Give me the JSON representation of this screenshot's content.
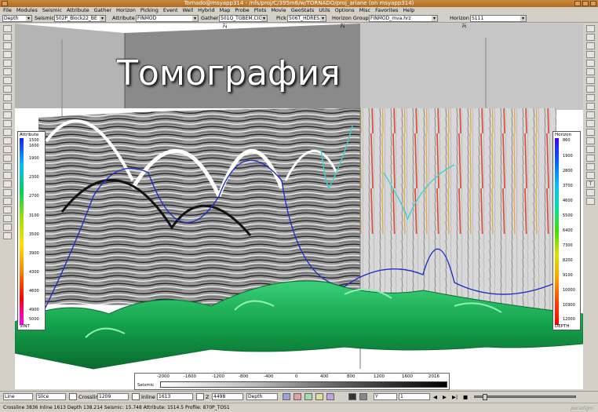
{
  "window": {
    "title": "Tornado@msyapp314 - /nfs/proj/C/395m6/w/TORNADO/proj_ariane (on msyapp314)"
  },
  "menu": [
    "File",
    "Modules",
    "Seismic",
    "Attribute",
    "Gather",
    "Horizon",
    "Picking",
    "Event",
    "Well",
    "Hybrid",
    "Map",
    "Probe",
    "Plots",
    "Movie",
    "GeoStats",
    "Utils",
    "Options",
    "Misc",
    "Favorites",
    "Help"
  ],
  "selectors": {
    "depth": "Depth",
    "seismic_label": "Seismic",
    "seismic_value": "502P_Block22_BE",
    "attribute_label": "Attribute",
    "attribute_value": "FINMOD",
    "gather_label": "Gather",
    "gather_value": "501Q_TGBEM.CIG",
    "pick_label": "Pick",
    "pick_value": "506T_HDRES.cig",
    "horizon_group_label": "Horizon Group",
    "horizon_group_value": "FINMOD_mva.hrz",
    "horizon_label": "Horizon",
    "horizon_value": "S111"
  },
  "overlay_title": "Томография",
  "scene_top_labels": [
    "29",
    "29",
    "3986"
  ],
  "attribute_bar": {
    "title": "Attribute",
    "ticks": [
      "1500",
      "1900",
      "2300",
      "2700",
      "3100",
      "3500",
      "3900",
      "4300",
      "4600",
      "4900",
      "5000"
    ],
    "top_values": [
      "1500",
      "1600"
    ],
    "footer": "VINT"
  },
  "horizon_bar": {
    "title": "Horizon",
    "ticks": [
      "860",
      "1900",
      "2800",
      "3700",
      "4600",
      "5500",
      "6400",
      "7300",
      "8200",
      "9100",
      "10000",
      "10900",
      "12000"
    ],
    "footer": "DEPTH"
  },
  "amplitude_bar": {
    "label": "Seismic",
    "ticks": [
      "-2000",
      "-1600",
      "-1200",
      "-800",
      "-400",
      "0",
      "400",
      "800",
      "1200",
      "1600",
      "2016"
    ]
  },
  "bottom": {
    "mode": "Line",
    "slice": "Slice",
    "crossline_label": "Crossline",
    "crossline_value": "1209",
    "inline_label": "Inline",
    "inline_value": "1613",
    "z_label": "Z",
    "z_value": "4498",
    "domain": "Depth",
    "axis": "Y",
    "step": "1"
  },
  "status": "Crossline 3836 Inline 1613 Depth 138.214  Seismic: 15.748 Attribute: 1514.5  Profile: 870P_TOS1",
  "colors": {
    "titlebar": "#c07a30",
    "horizon_green": "#18a050",
    "attr_top": "#1a1aff",
    "attr_bottom": "#ff00ff"
  }
}
